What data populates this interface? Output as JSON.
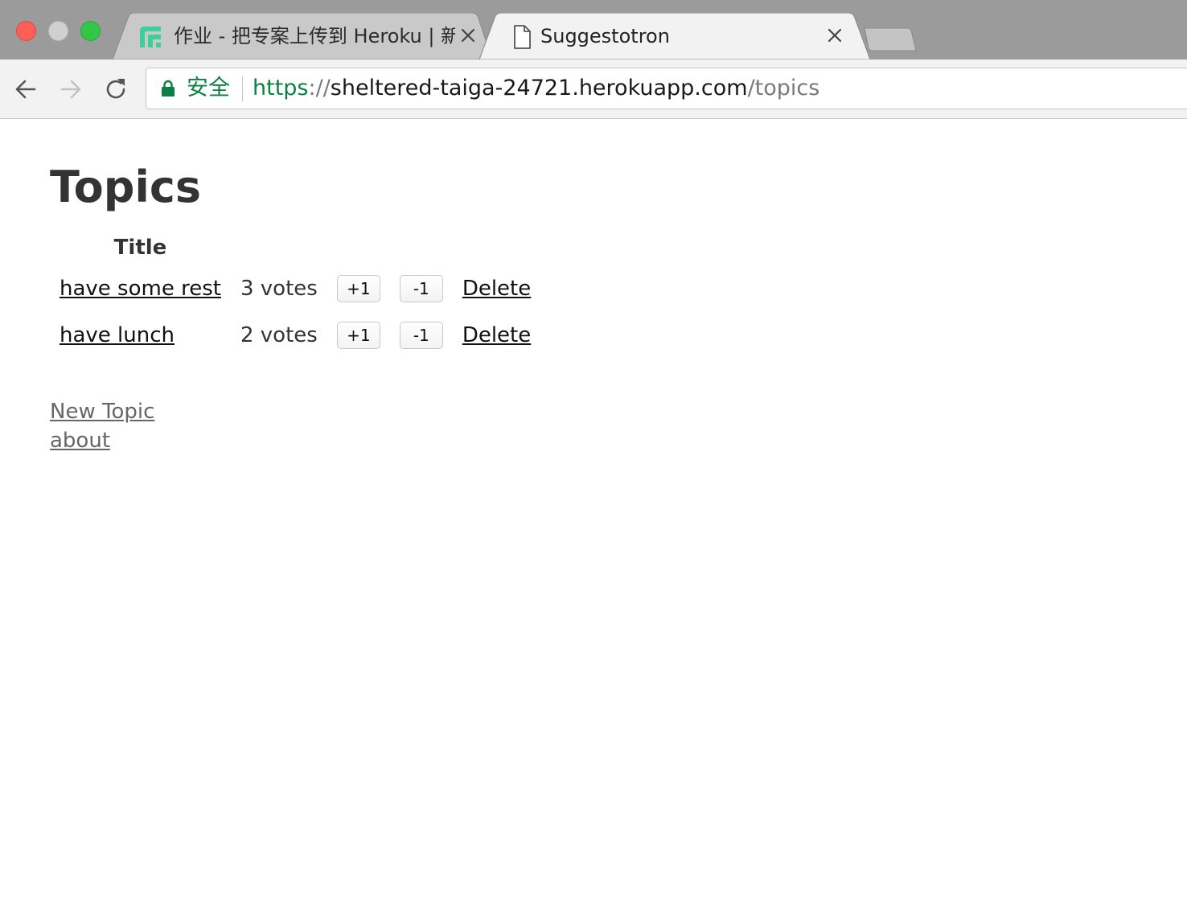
{
  "browser": {
    "tabs": [
      {
        "title": "作业 - 把专案上传到 Heroku | 新",
        "favicon": "logo-icon",
        "active": false
      },
      {
        "title": "Suggestotron",
        "favicon": "document-icon",
        "active": true
      }
    ],
    "omnibox": {
      "secure_label": "安全",
      "url_scheme": "https",
      "url_separator": "://",
      "url_host": "sheltered-taiga-24721.herokuapp.com",
      "url_path": "/topics"
    },
    "colors": {
      "titlebar": "#9b9b9b",
      "toolbar": "#f2f2f2",
      "secure_green": "#0b8043"
    }
  },
  "page": {
    "title": "Topics",
    "table": {
      "headers": [
        "Title"
      ],
      "rows": [
        {
          "title": "have some rest",
          "votes": "3 votes",
          "upvote": "+1",
          "downvote": "-1",
          "delete": "Delete"
        },
        {
          "title": "have lunch",
          "votes": "2 votes",
          "upvote": "+1",
          "downvote": "-1",
          "delete": "Delete"
        }
      ]
    },
    "links": {
      "new_topic": "New Topic",
      "about": "about"
    }
  }
}
